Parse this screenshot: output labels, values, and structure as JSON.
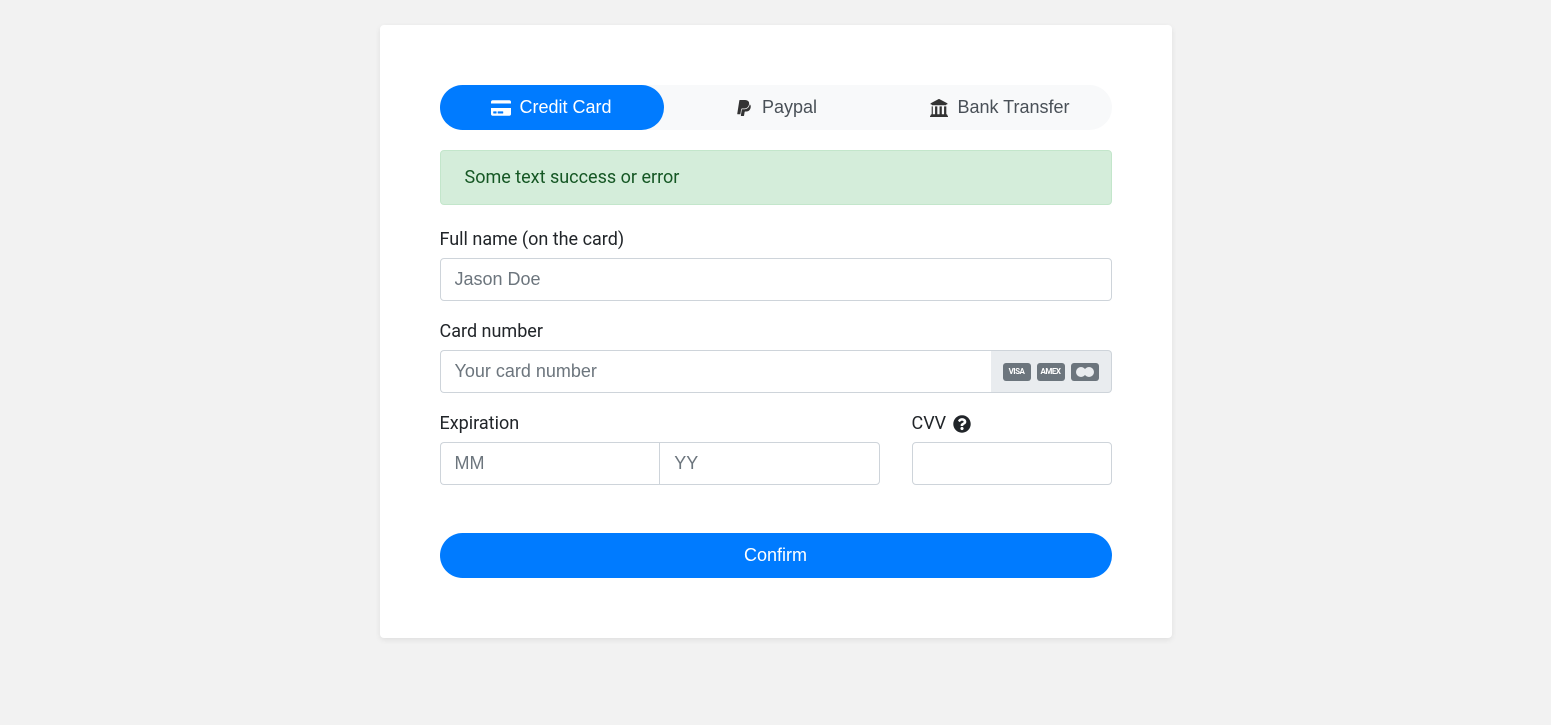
{
  "tabs": {
    "credit_card": "Credit Card",
    "paypal": "Paypal",
    "bank_transfer": "Bank Transfer"
  },
  "alert_text": "Some text success or error",
  "labels": {
    "fullname": "Full name (on the card)",
    "cardnumber": "Card number",
    "expiration": "Expiration",
    "cvv": "CVV"
  },
  "placeholders": {
    "fullname": "Jason Doe",
    "cardnumber": "Your card number",
    "mm": "MM",
    "yy": "YY"
  },
  "card_brands": {
    "visa": "VISA",
    "amex": "AMEX"
  },
  "confirm_label": "Confirm"
}
